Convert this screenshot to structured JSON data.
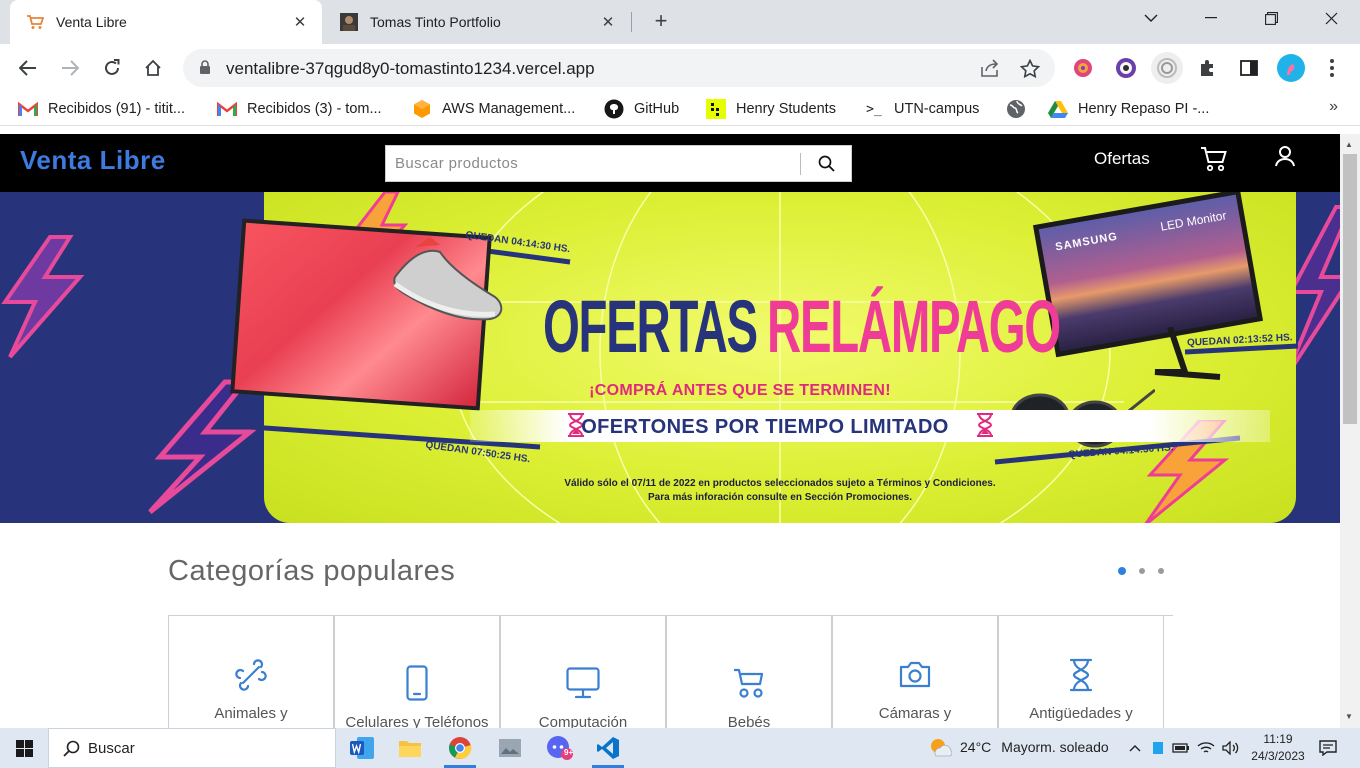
{
  "browser": {
    "tabs": [
      {
        "title": "Venta Libre",
        "active": true,
        "favicon": "shopping-cart-icon"
      },
      {
        "title": "Tomas Tinto Portfolio",
        "active": false,
        "favicon": "profile-photo-icon"
      }
    ],
    "url": "ventalibre-37qgud8y0-tomastinto1234.vercel.app",
    "bookmarks": [
      {
        "label": "Recibidos (91) - titit...",
        "icon": "gmail-icon"
      },
      {
        "label": "Recibidos (3) - tom...",
        "icon": "gmail-icon"
      },
      {
        "label": "AWS Management...",
        "icon": "aws-icon"
      },
      {
        "label": "GitHub",
        "icon": "github-icon"
      },
      {
        "label": "Henry Students",
        "icon": "henry-icon"
      },
      {
        "label": "UTN-campus",
        "icon": "utn-icon"
      },
      {
        "label": "",
        "icon": "globe-icon"
      },
      {
        "label": "Henry Repaso PI -...",
        "icon": "google-drive-icon"
      }
    ]
  },
  "site": {
    "brand": "Venta Libre",
    "search_placeholder": "Buscar productos",
    "nav_ofertas": "Ofertas"
  },
  "banner": {
    "headline_part1": "OFERTAS",
    "headline_part2": "RELÁMPAGO",
    "subline": "¡COMPRÁ ANTES QUE SE TERMINEN!",
    "strip": "OFERTONES POR TIEMPO LIMITADO",
    "timers": [
      "QUEDAN 04:14:30 HS.",
      "QUEDAN 07:50:25 HS.",
      "QUEDAN 02:13:52 HS.",
      "QUEDAN 04:14:30 HS."
    ],
    "monitor_brand": "SAMSUNG",
    "monitor_model": "LED Monitor",
    "fine_print_1": "Válido sólo el 07/11 de 2022 en productos seleccionados sujeto a Términos y Condiciones.",
    "fine_print_2": "Para más inforación consulte en Sección Promociones."
  },
  "categories": {
    "title": "Categorías populares",
    "items": [
      {
        "label": "Animales y",
        "icon": "bone-icon"
      },
      {
        "label": "Celulares y Teléfonos",
        "icon": "smartphone-icon"
      },
      {
        "label": "Computación",
        "icon": "monitor-icon"
      },
      {
        "label": "Bebés",
        "icon": "stroller-icon"
      },
      {
        "label": "Cámaras y",
        "icon": "camera-icon"
      },
      {
        "label": "Antigüedades y",
        "icon": "hourglass-icon"
      }
    ],
    "active_page": 1,
    "page_count": 3
  },
  "taskbar": {
    "search_label": "Buscar",
    "weather_temp": "24°C",
    "weather_desc": "Mayorm. soleado",
    "time": "11:19",
    "date": "24/3/2023",
    "notification_badge": "9+"
  },
  "colors": {
    "brand_blue": "#3d7be0",
    "banner_navy": "#27337a",
    "banner_yellow": "#dcef34",
    "banner_pink": "#ef3c96",
    "carousel_active": "#2f7fe0"
  }
}
